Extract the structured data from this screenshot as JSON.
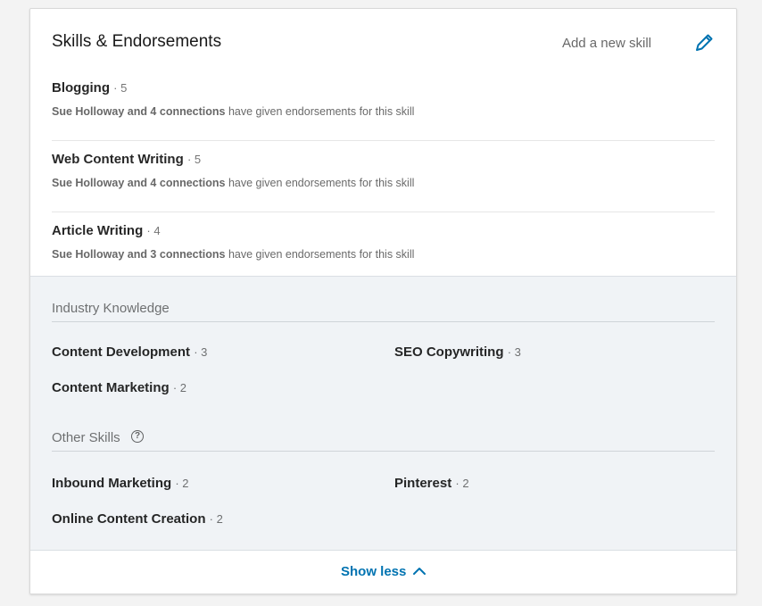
{
  "header": {
    "title": "Skills & Endorsements",
    "add_skill": "Add a new skill",
    "edit_icon": "pencil-icon"
  },
  "top_skills": [
    {
      "name": "Blogging",
      "count": "· 5",
      "endorser": "Sue Holloway and 4 connections",
      "text": " have given endorsements for this skill"
    },
    {
      "name": "Web Content Writing",
      "count": "· 5",
      "endorser": "Sue Holloway and 4 connections",
      "text": " have given endorsements for this skill"
    },
    {
      "name": "Article Writing",
      "count": "· 4",
      "endorser": "Sue Holloway and 3 connections",
      "text": " have given endorsements for this skill"
    }
  ],
  "industry": {
    "title": "Industry Knowledge",
    "skills": [
      {
        "name": "Content Development",
        "count": "· 3"
      },
      {
        "name": "SEO Copywriting",
        "count": "· 3"
      },
      {
        "name": "Content Marketing",
        "count": "· 2"
      }
    ]
  },
  "other": {
    "title": "Other Skills",
    "help_icon": "question-circle-icon",
    "skills": [
      {
        "name": "Inbound Marketing",
        "count": "· 2"
      },
      {
        "name": "Pinterest",
        "count": "· 2"
      },
      {
        "name": "Online Content Creation",
        "count": "· 2"
      }
    ]
  },
  "footer": {
    "show_less": "Show less",
    "icon": "chevron-up-icon",
    "accent": "#0073b1"
  }
}
